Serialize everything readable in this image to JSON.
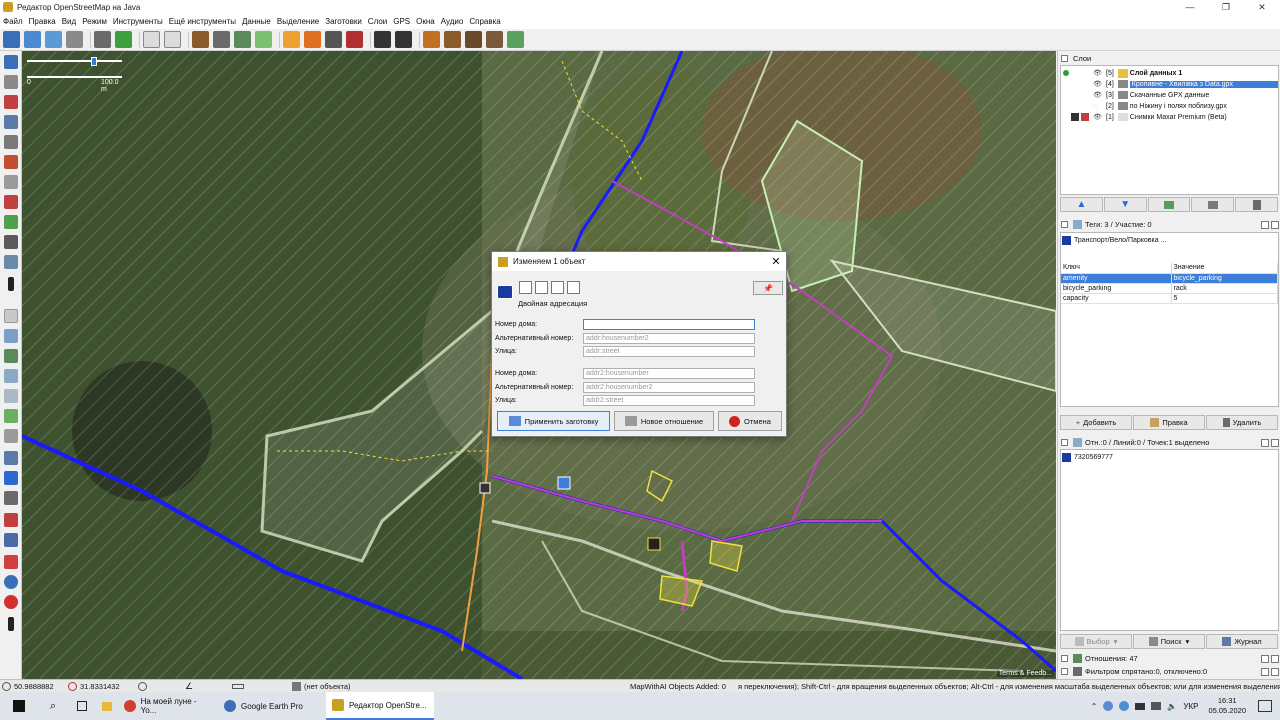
{
  "window": {
    "title": "Редактор OpenStreetMap на Java"
  },
  "menu": [
    "Файл",
    "Правка",
    "Вид",
    "Режим",
    "Инструменты",
    "Ещё инструменты",
    "Данные",
    "Выделение",
    "Заготовки",
    "Слои",
    "GPS",
    "Окна",
    "Аудио",
    "Справка"
  ],
  "map": {
    "scale_left": "0",
    "scale_right": "100.0 m",
    "attribution": "Terms & Feedb..."
  },
  "dialog": {
    "title": "Изменяем 1 объект",
    "section_label": "Двойная адресация",
    "fields": [
      {
        "label": "Номер дома:",
        "value": "",
        "placeholder": ""
      },
      {
        "label": "Альтернативный номер:",
        "value": "",
        "placeholder": "addr:housenumber2"
      },
      {
        "label": "Улица:",
        "value": "",
        "placeholder": "addr:street"
      },
      {
        "label": "Номер дома:",
        "value": "",
        "placeholder": "addr2:housenumber"
      },
      {
        "label": "Альтернативный номер:",
        "value": "",
        "placeholder": "addr2:housenumber2"
      },
      {
        "label": "Улица:",
        "value": "",
        "placeholder": "addr2:street"
      }
    ],
    "apply_label": "Применить заготовку",
    "relation_label": "Новое отношение",
    "cancel_label": "Отмена"
  },
  "layers_panel": {
    "title": "Слои",
    "layers": [
      {
        "num": "[5]",
        "name": "Слой данных 1",
        "active": true,
        "selected": false
      },
      {
        "num": "[4]",
        "name": "Кропивне - Хвилівка з Data.gpx",
        "active": false,
        "selected": true
      },
      {
        "num": "[3]",
        "name": "Скачанные GPX данные",
        "active": false,
        "selected": false
      },
      {
        "num": "[2]",
        "name": "по Ніжину і полях поблизу.gpx",
        "active": false,
        "selected": false
      },
      {
        "num": "[1]",
        "name": "Снимки Maxar Premium (Beta)",
        "active": false,
        "selected": false
      }
    ]
  },
  "tags_panel": {
    "title": "Теги: 3 / Участие: 0",
    "preset": "Транспорт/Вело/Парковка ...",
    "col_key": "Ключ",
    "col_value": "Значение",
    "rows": [
      {
        "key": "amenity",
        "value": "bicycle_parking"
      },
      {
        "key": "bicycle_parking",
        "value": "rack"
      },
      {
        "key": "capacity",
        "value": "5"
      }
    ],
    "add_label": "Добавить",
    "edit_label": "Правка",
    "delete_label": "Удалить"
  },
  "selection_panel": {
    "title": "Отн.:0 / Линий:0 / Точек:1 выделено",
    "items": [
      "7320569777"
    ],
    "select_label": "Выбор",
    "search_label": "Поиск",
    "history_label": "Журнал"
  },
  "relations_panel": {
    "title": "Отношения: 47"
  },
  "filter_panel": {
    "title": "Фильтром спрятано:0, отключено:0"
  },
  "status": {
    "lat": "50.9888882",
    "lon": "31.8331432",
    "object": "(нет объекта)",
    "mapwithai": "MapWithAI Objects Added: 0",
    "help": "я переключения); Shift-Ctrl - для вращения выделенных объектов; Alt-Ctrl - для изменения масштаба выделенных объектов; или для изменения выделения"
  },
  "taskbar": {
    "tasks": [
      "На моей луне - Yo...",
      "Google Earth Pro",
      "Редактор OpenStre..."
    ],
    "lang": "УКР",
    "time": "16:31",
    "date": "05.05.2020"
  },
  "colors": {
    "selection": "#3d7ed8",
    "way_blue": "#1a1aff",
    "way_magenta": "#c040c0",
    "way_orange": "#f0a040"
  }
}
